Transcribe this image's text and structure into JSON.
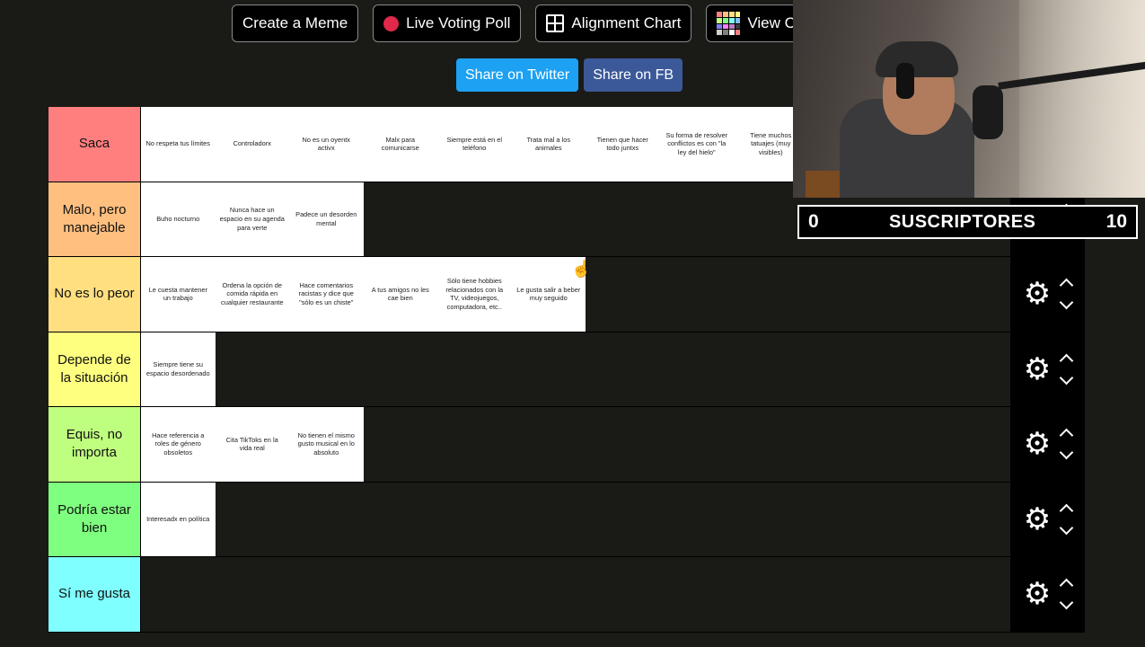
{
  "toolbar": {
    "buttons": [
      {
        "label": "Create a Meme"
      },
      {
        "label": "Live Voting Poll"
      },
      {
        "label": "Alignment Chart"
      },
      {
        "label": "View Co"
      }
    ]
  },
  "share": {
    "twitter": {
      "label": "Share on Twitter",
      "color": "#1da1f2"
    },
    "facebook": {
      "label": "Share on FB",
      "color": "#3b5998"
    }
  },
  "tiers": [
    {
      "label": "Saca",
      "color": "#ff7f7f",
      "items": [
        "No respeta tus límites",
        "Controladorx",
        "No es un oyentx activx",
        "Malx para comunicarse",
        "Siempre está en el teléfono",
        "Trata mal a los animales",
        "Tienen que hacer todo juntxs",
        "Su forma de resolver conflictos es con \"la ley del hielo\"",
        "Tiene muchos tatuajes (muy visibles)"
      ]
    },
    {
      "label": "Malo, pero manejable",
      "color": "#ffbf7f",
      "items": [
        "Buho nocturno",
        "Nunca hace un espacio en su agenda para verte",
        "Padece un desorden mental"
      ]
    },
    {
      "label": "No es lo peor",
      "color": "#ffdf7f",
      "items": [
        "Le cuesta mantener un trabajo",
        "Ordena la opción de comida rápida en cualquier restaurante",
        "Hace comentarios racistas y dice que \"sólo es un chiste\"",
        "A tus amigos no les cae bien",
        "Sólo tiene hobbies relacionados con la TV, videojuegos, computadora, etc..",
        "Le gusta salir a beber muy seguido"
      ]
    },
    {
      "label": "Depende de la situación",
      "color": "#ffff7f",
      "items": [
        "Siempre tiene su espacio desordenado"
      ]
    },
    {
      "label": "Equis, no importa",
      "color": "#bfff7f",
      "items": [
        "Hace referencia a roles de género obsoletos",
        "Cita TikToks en la vida real",
        "No tienen el mismo gusto musical en lo absoluto"
      ]
    },
    {
      "label": "Podría estar bien",
      "color": "#7fff7f",
      "items": [
        "Interesadx en política"
      ]
    },
    {
      "label": "Sí me gusta",
      "color": "#7fffff",
      "items": []
    }
  ],
  "overlay": {
    "sub_counter": {
      "current": "0",
      "title": "SUSCRIPTORES",
      "goal": "10"
    }
  },
  "icons": {
    "gear": "gear-icon",
    "up": "chevron-up-icon",
    "down": "chevron-down-icon",
    "cursor": "hand-cursor-icon"
  }
}
